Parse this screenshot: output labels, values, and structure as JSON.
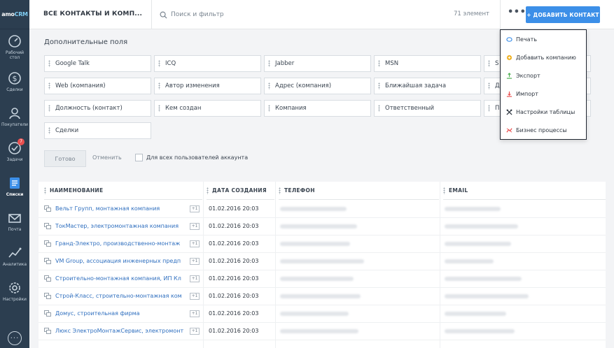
{
  "sidebar": {
    "logo_main": "amo",
    "logo_sub": "CRM",
    "items": [
      {
        "label": "Рабочий стол",
        "icon": "dashboard-icon"
      },
      {
        "label": "Сделки",
        "icon": "dollar-icon"
      },
      {
        "label": "Покупатели",
        "icon": "customers-icon"
      },
      {
        "label": "Задачи",
        "icon": "tasks-icon",
        "badge": "7"
      },
      {
        "label": "Списки",
        "icon": "lists-icon",
        "active": true
      },
      {
        "label": "Почта",
        "icon": "mail-icon"
      },
      {
        "label": "Аналитика",
        "icon": "analytics-icon"
      },
      {
        "label": "Настройки",
        "icon": "settings-icon"
      }
    ],
    "more": "..."
  },
  "topbar": {
    "title": "ВСЕ КОНТАКТЫ И КОМП...",
    "search_placeholder": "Поиск и фильтр",
    "count": "71 элемент",
    "more": "•••",
    "add_button": "+ ДОБАВИТЬ КОНТАКТ"
  },
  "fields": {
    "title": "Дополнительные поля",
    "rows": [
      [
        "Google Talk",
        "ICQ",
        "Jabber",
        "MSN",
        "S"
      ],
      [
        "Web (компания)",
        "Автор изменения",
        "Адрес (компания)",
        "Ближайшая задача",
        "Д"
      ],
      [
        "Должность (контакт)",
        "Кем создан",
        "Компания",
        "Ответственный",
        "П"
      ],
      [
        "Сделки"
      ]
    ],
    "ready_button": "Готово",
    "cancel_button": "Отменить",
    "all_users_label": "Для всех пользователей аккаунта"
  },
  "table": {
    "headers": [
      "НАИМЕНОВАНИЕ",
      "ДАТА СОЗДАНИЯ",
      "ТЕЛЕФОН",
      "EMAIL"
    ],
    "rows": [
      {
        "name": "Вельт Групп, монтажная компания",
        "date": "01.02.2016 20:03"
      },
      {
        "name": "ТокМастер, электромонтажная компания",
        "date": "01.02.2016 20:03"
      },
      {
        "name": "Гранд-Электро, производственно-монтаж",
        "date": "01.02.2016 20:03"
      },
      {
        "name": "VM Group, ассоциация инженерных предп",
        "date": "01.02.2016 20:03"
      },
      {
        "name": "Строительно-монтажная компания, ИП Кл",
        "date": "01.02.2016 20:03"
      },
      {
        "name": "Строй-Класс, строительно-монтажная ком",
        "date": "01.02.2016 20:03"
      },
      {
        "name": "Домус, строительная фирма",
        "date": "01.02.2016 20:03"
      },
      {
        "name": "Люкс ЭлектроМонтажСервис, электромонт",
        "date": "01.02.2016 20:03"
      }
    ],
    "plus_label": "+1"
  },
  "dropdown": {
    "items": [
      {
        "label": "Печать",
        "icon": "print-icon",
        "color": "#3c8fe8"
      },
      {
        "label": "Добавить компанию",
        "icon": "add-company-icon",
        "color": "#f0b429"
      },
      {
        "label": "Экспорт",
        "icon": "export-icon",
        "color": "#4caf50"
      },
      {
        "label": "Импорт",
        "icon": "import-icon",
        "color": "#e94f4f"
      },
      {
        "label": "Настройки таблицы",
        "icon": "table-settings-icon",
        "color": "#2e3640"
      },
      {
        "label": "Бизнес процессы",
        "icon": "business-process-icon",
        "color": "#e94f4f"
      }
    ]
  },
  "colors": {
    "sidebar_bg": "#2c3e50",
    "accent": "#3c8fe8",
    "link": "#2f6fbf"
  }
}
